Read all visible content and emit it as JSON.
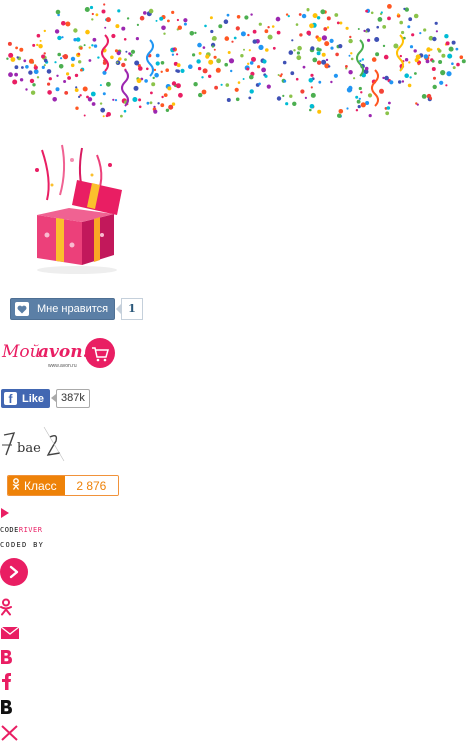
{
  "vk_like": {
    "label": "Мне нравится",
    "count": "1"
  },
  "avon_logo": {
    "text": "Мой avon.ru",
    "sub": "www.avon.ru"
  },
  "fb_like": {
    "label": "Like",
    "count": "387k"
  },
  "signature": {
    "text": "Zbae 2"
  },
  "ok_class": {
    "label": "Класс",
    "count": "2 876"
  },
  "credits": {
    "code": "CODE",
    "river": "RIVER",
    "coded_by": "CODED BY"
  },
  "colors": {
    "accent": "#e91e63",
    "vk": "#5b7fa6",
    "fb": "#4267b2",
    "ok": "#ee8208"
  },
  "icons": [
    "play-icon",
    "arrow-right-icon",
    "odnoklassniki-icon",
    "mail-icon",
    "vk-icon",
    "facebook-icon",
    "vk-icon",
    "close-icon"
  ]
}
